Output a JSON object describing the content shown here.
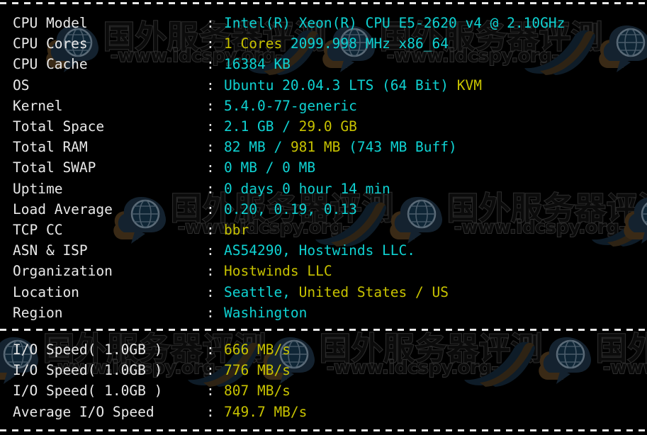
{
  "terminal": {
    "title": "Server Benchmark Output",
    "background_color": "#000000",
    "label_color": "#e9e9e9",
    "cyan_color": "#0fd2d2",
    "yellow_color": "#c7c200",
    "separator_color": "#e8e8e8",
    "separator_char": "-"
  },
  "watermark": {
    "chinese_text": "国外服务器评测",
    "url_text": "-www.idcspy.org-",
    "logo_name": "cloud-globe-logo"
  },
  "system_info": {
    "section_name": "system-info",
    "rows": [
      {
        "label": "CPU Model",
        "separator": ":",
        "segments": [
          {
            "text": "Intel(R) Xeon(R) CPU E5-2620 v4 @ 2.10GHz",
            "color": "cyan"
          }
        ]
      },
      {
        "label": "CPU Cores",
        "separator": ":",
        "segments": [
          {
            "text": "1 Cores",
            "color": "yellow"
          },
          {
            "text": " 2099.998 MHz x86_64",
            "color": "cyan"
          }
        ]
      },
      {
        "label": "CPU Cache",
        "separator": ":",
        "segments": [
          {
            "text": "16384 KB",
            "color": "cyan"
          }
        ]
      },
      {
        "label": "OS",
        "separator": ":",
        "segments": [
          {
            "text": "Ubuntu 20.04.3 LTS (64 Bit) ",
            "color": "cyan"
          },
          {
            "text": "KVM",
            "color": "yellow"
          }
        ]
      },
      {
        "label": "Kernel",
        "separator": ":",
        "segments": [
          {
            "text": "5.4.0-77-generic",
            "color": "cyan"
          }
        ]
      },
      {
        "label": "Total Space",
        "separator": ":",
        "segments": [
          {
            "text": "2.1 GB ",
            "color": "cyan"
          },
          {
            "text": "/ ",
            "color": "cyan"
          },
          {
            "text": "29.0 GB",
            "color": "yellow"
          }
        ]
      },
      {
        "label": "Total RAM",
        "separator": ":",
        "segments": [
          {
            "text": "82 MB ",
            "color": "cyan"
          },
          {
            "text": "/ ",
            "color": "cyan"
          },
          {
            "text": "981 MB",
            "color": "yellow"
          },
          {
            "text": " (743 MB Buff)",
            "color": "cyan"
          }
        ]
      },
      {
        "label": "Total SWAP",
        "separator": ":",
        "segments": [
          {
            "text": "0 MB / 0 MB",
            "color": "cyan"
          }
        ]
      },
      {
        "label": "Uptime",
        "separator": ":",
        "segments": [
          {
            "text": "0 days 0 hour 14 min",
            "color": "cyan"
          }
        ]
      },
      {
        "label": "Load Average",
        "separator": ":",
        "segments": [
          {
            "text": "0.20, 0.19, 0.13",
            "color": "cyan"
          }
        ]
      },
      {
        "label": "TCP CC",
        "separator": ":",
        "segments": [
          {
            "text": "bbr",
            "color": "yellow"
          }
        ]
      },
      {
        "label": "ASN & ISP",
        "separator": ":",
        "segments": [
          {
            "text": "AS54290, Hostwinds LLC.",
            "color": "cyan"
          }
        ]
      },
      {
        "label": "Organization",
        "separator": ":",
        "segments": [
          {
            "text": "Hostwinds LLC",
            "color": "yellow"
          }
        ]
      },
      {
        "label": "Location",
        "separator": ":",
        "segments": [
          {
            "text": "Seattle, ",
            "color": "cyan"
          },
          {
            "text": "United States / US",
            "color": "yellow"
          }
        ]
      },
      {
        "label": "Region",
        "separator": ":",
        "segments": [
          {
            "text": "Washington",
            "color": "cyan"
          }
        ]
      }
    ]
  },
  "io_benchmark": {
    "section_name": "io-speed-results",
    "rows": [
      {
        "label": "I/O Speed( 1.0GB )",
        "separator": ":",
        "segments": [
          {
            "text": "666 MB/s",
            "color": "yellow"
          }
        ]
      },
      {
        "label": "I/O Speed( 1.0GB )",
        "separator": ":",
        "segments": [
          {
            "text": "776 MB/s",
            "color": "yellow"
          }
        ]
      },
      {
        "label": "I/O Speed( 1.0GB )",
        "separator": ":",
        "segments": [
          {
            "text": "807 MB/s",
            "color": "yellow"
          }
        ]
      },
      {
        "label": "Average I/O Speed",
        "separator": ":",
        "segments": [
          {
            "text": "749.7 MB/s",
            "color": "yellow"
          }
        ]
      }
    ]
  }
}
